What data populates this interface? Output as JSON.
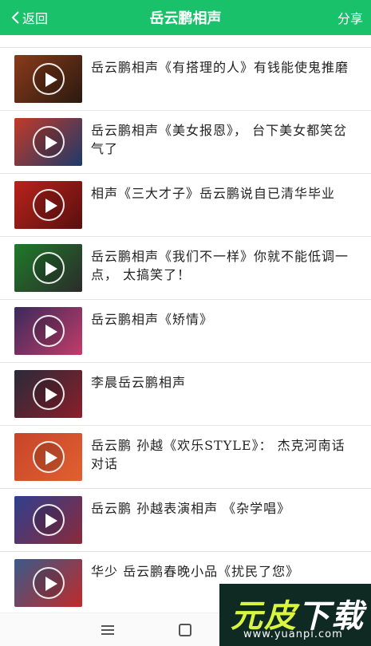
{
  "header": {
    "back_label": "返回",
    "title": "岳云鹏相声",
    "share_label": "分享",
    "background_color": "#19c16a"
  },
  "videos": [
    {
      "caption": "岳云鹏相声《有搭理的人》有钱能使鬼推磨",
      "thumb_colors": [
        "#8a3a1a",
        "#2a1a10"
      ]
    },
    {
      "caption": "岳云鹏相声《美女报恩》， 台下美女都笑岔气了",
      "thumb_colors": [
        "#c23a28",
        "#1d3a6a"
      ]
    },
    {
      "caption": "相声《三大才子》岳云鹏说自已清华毕业",
      "thumb_colors": [
        "#b8231b",
        "#5a0f0f"
      ]
    },
    {
      "caption": "岳云鹏相声《我们不一样》你就不能低调一点， 太搞笑了！",
      "thumb_colors": [
        "#1f7a2a",
        "#2b2b2b"
      ]
    },
    {
      "caption": "岳云鹏相声《矫情》",
      "thumb_colors": [
        "#3a2a5a",
        "#c23c6a"
      ]
    },
    {
      "caption": "李晨岳云鹏相声",
      "thumb_colors": [
        "#2a2a3a",
        "#8a1f2a"
      ]
    },
    {
      "caption": "岳云鹏 孙越《欢乐STYLE》： 杰克河南话对话",
      "thumb_colors": [
        "#c8452a",
        "#e06030"
      ]
    },
    {
      "caption": "岳云鹏 孙越表演相声 《杂学唱》",
      "thumb_colors": [
        "#2f3f8f",
        "#8a2a3a"
      ]
    },
    {
      "caption": "华少 岳云鹏春晚小品《扰民了您》",
      "thumb_colors": [
        "#3a5a8a",
        "#c02a2a"
      ]
    }
  ],
  "watermark": {
    "logo_text_1": "元皮",
    "logo_text_2": "下载",
    "url": "www.yuanpi.com"
  },
  "icons": {
    "back": "chevron-left-icon",
    "play": "play-icon",
    "nav_menu": "menu-icon",
    "nav_home": "home-square-icon"
  }
}
